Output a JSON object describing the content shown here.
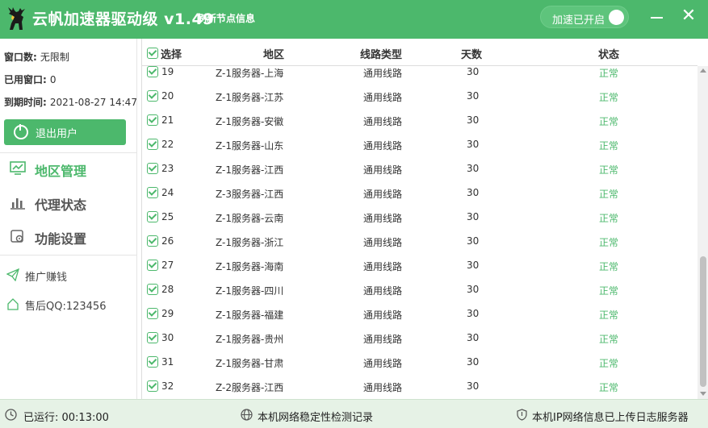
{
  "titlebar": {
    "app_title": "云帆加速器驱动级 v1.49",
    "refresh_link": "刷新节点信息",
    "toggle_label": "加速已开启",
    "toggle_on": true,
    "close_glyph": "✕"
  },
  "sidebar": {
    "window_count_label": "窗口数:",
    "window_count_value": "无限制",
    "used_windows_label": "已用窗口:",
    "used_windows_value": "0",
    "expiry_label": "到期时间:",
    "expiry_value": "2021-08-27 14:47",
    "logout_label": "退出用户",
    "nav": [
      {
        "label": "地区管理",
        "icon": "monitor-chart-icon",
        "active": true
      },
      {
        "label": "代理状态",
        "icon": "bar-chart-icon",
        "active": false
      },
      {
        "label": "功能设置",
        "icon": "settings-icon",
        "active": false
      }
    ],
    "links": [
      {
        "label": "推广赚钱",
        "icon": "paper-plane-icon"
      },
      {
        "label": "售后QQ:123456",
        "icon": "home-icon"
      }
    ]
  },
  "table": {
    "headers": {
      "select": "选择",
      "region": "地区",
      "line_type": "线路类型",
      "days": "天数",
      "status": "状态"
    },
    "rows": [
      {
        "num": "19",
        "region": "Z-1服务器-上海",
        "type": "通用线路",
        "days": "30",
        "status": "正常"
      },
      {
        "num": "20",
        "region": "Z-1服务器-江苏",
        "type": "通用线路",
        "days": "30",
        "status": "正常"
      },
      {
        "num": "21",
        "region": "Z-1服务器-安徽",
        "type": "通用线路",
        "days": "30",
        "status": "正常"
      },
      {
        "num": "22",
        "region": "Z-1服务器-山东",
        "type": "通用线路",
        "days": "30",
        "status": "正常"
      },
      {
        "num": "23",
        "region": "Z-1服务器-江西",
        "type": "通用线路",
        "days": "30",
        "status": "正常"
      },
      {
        "num": "24",
        "region": "Z-3服务器-江西",
        "type": "通用线路",
        "days": "30",
        "status": "正常"
      },
      {
        "num": "25",
        "region": "Z-1服务器-云南",
        "type": "通用线路",
        "days": "30",
        "status": "正常"
      },
      {
        "num": "26",
        "region": "Z-1服务器-浙江",
        "type": "通用线路",
        "days": "30",
        "status": "正常"
      },
      {
        "num": "27",
        "region": "Z-1服务器-海南",
        "type": "通用线路",
        "days": "30",
        "status": "正常"
      },
      {
        "num": "28",
        "region": "Z-1服务器-四川",
        "type": "通用线路",
        "days": "30",
        "status": "正常"
      },
      {
        "num": "29",
        "region": "Z-1服务器-福建",
        "type": "通用线路",
        "days": "30",
        "status": "正常"
      },
      {
        "num": "30",
        "region": "Z-1服务器-贵州",
        "type": "通用线路",
        "days": "30",
        "status": "正常"
      },
      {
        "num": "31",
        "region": "Z-1服务器-甘肃",
        "type": "通用线路",
        "days": "30",
        "status": "正常"
      },
      {
        "num": "32",
        "region": "Z-2服务器-江西",
        "type": "通用线路",
        "days": "30",
        "status": "正常"
      }
    ]
  },
  "statusbar": {
    "runtime": "已运行: 00:13:00",
    "network_check": "本机网络稳定性检测记录",
    "upload_info": "本机IP网络信息已上传日志服务器"
  },
  "colors": {
    "brand": "#4cb86c",
    "status_ok": "#4cb86c",
    "statusbar_bg": "#e6f2e6"
  }
}
